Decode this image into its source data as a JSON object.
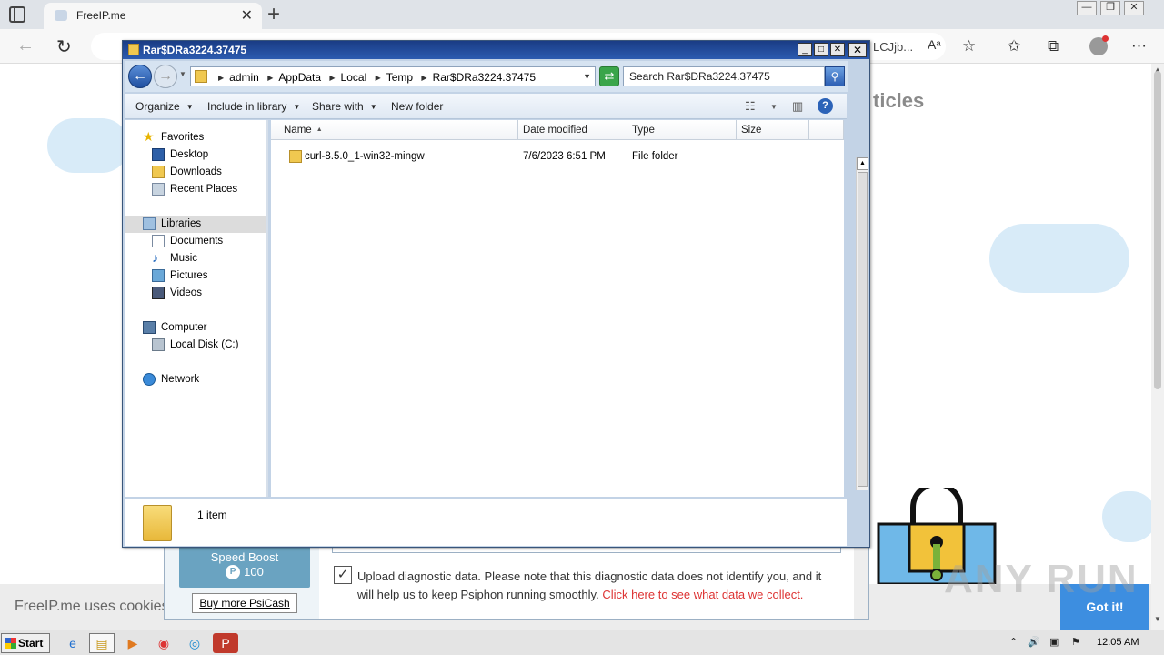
{
  "browser": {
    "tab_title": "FreeIP.me",
    "tab_close": "✕",
    "new_tab": "+",
    "address_partial": "LCJjb...",
    "window_controls": [
      "—",
      "❐",
      "✕"
    ],
    "toolbar_icons": [
      "read-aloud-icon",
      "add-favorite-icon",
      "favorites-icon",
      "collections-icon",
      "profile-icon",
      "more-icon"
    ]
  },
  "page": {
    "heading_partial": "ticles",
    "cookie_text": "FreeIP.me uses cookies",
    "got_it": "Got it!"
  },
  "psiphon": {
    "speed_boost_label": "Speed Boost",
    "speed_boost_value": "100",
    "psicash_symbol": "P",
    "buy_more": "Buy more PsiCash",
    "diagnostic_text": "Upload diagnostic data. Please note that this diagnostic data does not identify you, and it will help us to keep Psiphon running smoothly. ",
    "diagnostic_link": "Click here to see what data we collect.",
    "checkbox_checked": true
  },
  "explorer": {
    "title": "Rar$DRa3224.37475",
    "breadcrumb": [
      "admin",
      "AppData",
      "Local",
      "Temp",
      "Rar$DRa3224.37475"
    ],
    "search_placeholder": "Search Rar$DRa3224.37475",
    "commands": {
      "organize": "Organize",
      "include_in_library": "Include in library",
      "share_with": "Share with",
      "new_folder": "New folder"
    },
    "nav": {
      "favorites": "Favorites",
      "desktop": "Desktop",
      "downloads": "Downloads",
      "recent_places": "Recent Places",
      "libraries": "Libraries",
      "documents": "Documents",
      "music": "Music",
      "pictures": "Pictures",
      "videos": "Videos",
      "computer": "Computer",
      "local_disk": "Local Disk (C:)",
      "network": "Network"
    },
    "columns": [
      "Name",
      "Date modified",
      "Type",
      "Size"
    ],
    "rows": [
      {
        "name": "curl-8.5.0_1-win32-mingw",
        "date": "7/6/2023 6:51 PM",
        "type": "File folder",
        "size": ""
      }
    ],
    "status": "1 item"
  },
  "taskbar": {
    "start": "Start",
    "clock": "12:05 AM"
  },
  "watermark": "ANY RUN",
  "colors": {
    "titlebar": "#1a3c85",
    "got_it": "#3d8ee0",
    "speed_boost": "#6aa3c1",
    "link": "#dd3333"
  }
}
